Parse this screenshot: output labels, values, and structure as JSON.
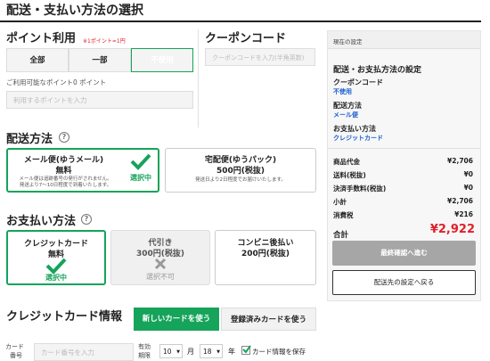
{
  "page_title": "配送・支払い方法の選択",
  "points": {
    "heading": "ポイント利用",
    "note": "※1ポイント=1円",
    "options": [
      "全部",
      "一部",
      "不使用"
    ],
    "selected": "不使用",
    "available_text": "ご利用可能なポイント0 ポイント",
    "input_placeholder": "利用するポイントを入力"
  },
  "coupon": {
    "heading": "クーポンコード",
    "input_placeholder": "クーポンコードを入力(半角英数)"
  },
  "shipping": {
    "heading": "配送方法",
    "help": "?",
    "options": [
      {
        "title": "メール便(ゆうメール)",
        "price": "無料",
        "desc1": "メール便は追跡番号の発行がされません。",
        "desc2": "発送より7〜10日程度で到着いたします。",
        "status": "選択中"
      },
      {
        "title": "宅配便(ゆうパック)",
        "price": "500円(税抜)",
        "desc1": "発送日より2日程度でお届けいたします。"
      }
    ]
  },
  "payment": {
    "heading": "お支払い方法",
    "help": "?",
    "options": [
      {
        "title": "クレジットカード",
        "price": "無料",
        "status": "選択中"
      },
      {
        "title": "代引き",
        "price": "300円(税抜)",
        "status": "選択不可"
      },
      {
        "title": "コンビニ後払い",
        "price": "200円(税抜)"
      }
    ]
  },
  "credit": {
    "heading": "クレジットカード情報",
    "tab_new": "新しいカードを使う",
    "tab_saved": "登録済みカードを使う",
    "card_label_1": "カード",
    "card_label_2": "番号",
    "card_placeholder": "カード番号を入力",
    "expiry_label_1": "有効",
    "expiry_label_2": "期限",
    "month_value": "10",
    "month_unit": "月",
    "year_value": "18",
    "year_unit": "年",
    "save_label": "カード情報を保存",
    "save_checked": true
  },
  "summary": {
    "header": "現在の設定",
    "title": "配送・お支払方法の設定",
    "coupon_label": "クーポンコード",
    "coupon_value": "不使用",
    "shipping_label": "配送方法",
    "shipping_value": "メール便",
    "payment_label": "お支払い方法",
    "payment_value": "クレジットカード",
    "rows": [
      {
        "label": "商品代金",
        "value": "¥2,706"
      },
      {
        "label": "送料(税抜)",
        "value": "¥0"
      },
      {
        "label": "決済手数料(税抜)",
        "value": "¥0"
      },
      {
        "label": "小計",
        "value": "¥2,706"
      },
      {
        "label": "消費税",
        "value": "¥216"
      }
    ],
    "total_label": "合計",
    "total_value": "¥2,922",
    "confirm_button": "最終確認へ進む",
    "back_button": "配送先の設定へ戻る"
  },
  "colors": {
    "accent": "#16a35a",
    "link": "#1a5fd0",
    "total": "#e0202a"
  }
}
